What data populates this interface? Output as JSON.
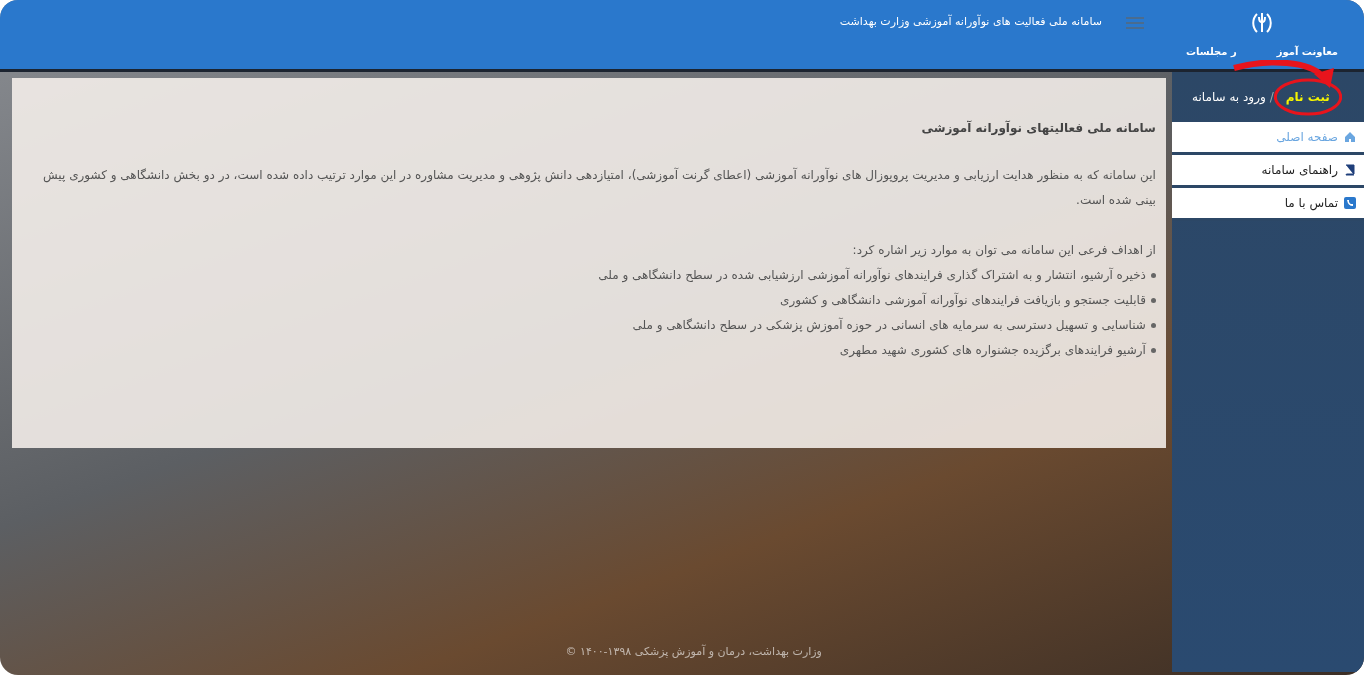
{
  "header": {
    "title": "سامانه ملی فعالیت های نوآورانه آموزشی وزارت بهداشت",
    "logo_caption": "معاونت آموز",
    "logo_caption_tail": "ر مجلسات"
  },
  "sidebar": {
    "auth_separator": "/",
    "auth_links": [
      {
        "label": "ثبت نام",
        "kind": "highlight"
      },
      {
        "label": "ورود به سامانه",
        "kind": "plain"
      }
    ],
    "items": [
      {
        "label": "صفحه اصلی",
        "selected": true
      },
      {
        "label": "راهنمای سامانه",
        "selected": false
      },
      {
        "label": "تماس با ما",
        "selected": false
      }
    ]
  },
  "content": {
    "heading": "سامانه ملی فعالیتهای نوآورانه آموزشی",
    "intro": "این سامانه که به منظور هدایت ارزیابی و مدیریت پروپوزال های نوآورانه آموزشی (اعطای گرنت آموزشی)، امتیازدهی دانش پژوهی و مدیریت مشاوره در این موارد ترتیب داده شده است، در دو بخش دانشگاهی و کشوری پیش بینی شده است.",
    "goals_title": "از اهداف فرعی این سامانه می توان به موارد زیر اشاره کرد:",
    "goals": [
      "ذخیره آرشیو، انتشار و به اشتراک گذاری فرایندهای نوآورانه آموزشی ارزشیابی شده در سطح دانشگاهی و ملی",
      "قابلیت جستجو و بازیافت فرایندهای نوآورانه آموزشی دانشگاهی و کشوری",
      "شناسایی و تسهیل دسترسی به سرمایه های انسانی در حوزه آموزش پزشکی در سطح دانشگاهی و ملی",
      "آرشیو فرایندهای برگزیده جشنواره های کشوری شهید مطهری"
    ]
  },
  "footer": {
    "copyright": "وزارت بهداشت، درمان و آموزش پزشکی ۱۳۹۸-۱۴۰۰ ©"
  }
}
